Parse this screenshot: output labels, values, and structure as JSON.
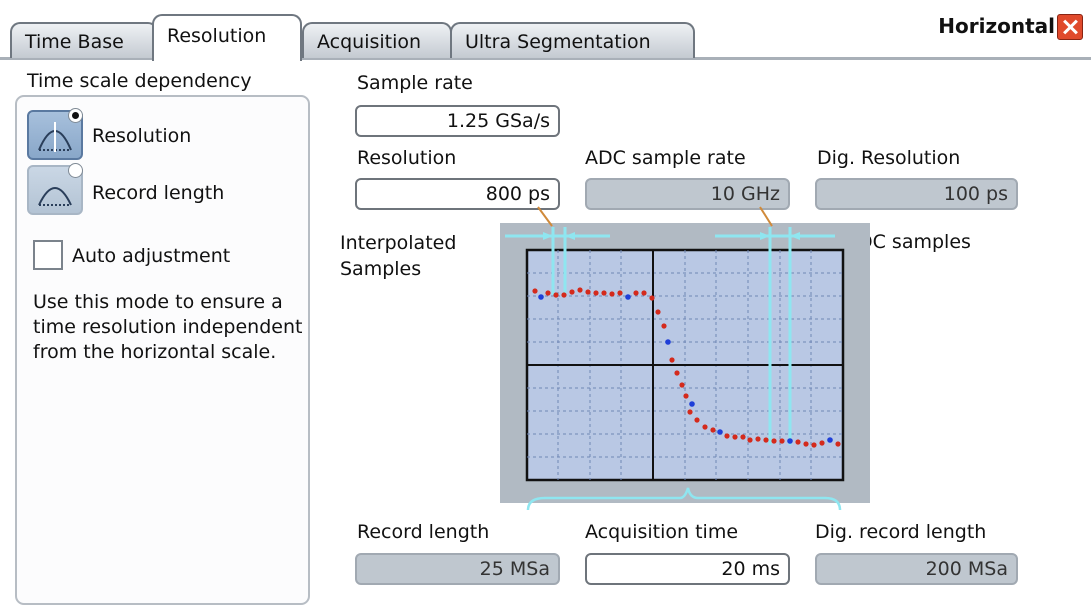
{
  "dialog": {
    "title": "Horizontal",
    "tabs": [
      {
        "label": "Time Base"
      },
      {
        "label": "Resolution"
      },
      {
        "label": "Acquisition"
      },
      {
        "label": "Ultra Segmentation"
      }
    ],
    "active_tab": "Resolution"
  },
  "left_panel": {
    "group_label": "Time scale dependency",
    "modes": [
      {
        "label": "Resolution",
        "selected": true,
        "icon": "resolution-mode-icon"
      },
      {
        "label": "Record length",
        "selected": false,
        "icon": "record-length-mode-icon"
      }
    ],
    "auto_adjustment": {
      "label": "Auto adjustment",
      "checked": false
    },
    "description": "Use this mode to ensure a time resolution independent from the horizontal scale."
  },
  "fields": {
    "sample_rate": {
      "label": "Sample rate",
      "value": "1.25 GSa/s"
    },
    "resolution": {
      "label": "Resolution",
      "value": "800 ps"
    },
    "adc_sample_rate": {
      "label": "ADC sample rate",
      "value": "10 GHz"
    },
    "dig_resolution": {
      "label": "Dig. Resolution",
      "value": "100 ps"
    },
    "record_length": {
      "label": "Record length",
      "value": "25 MSa"
    },
    "acquisition_time": {
      "label": "Acquisition time",
      "value": "20 ms"
    },
    "dig_record_length": {
      "label": "Dig. record length",
      "value": "200 MSa"
    }
  },
  "diagram": {
    "interpolated_label_line1": "Interpolated",
    "interpolated_label_line2": "Samples",
    "adc_label": "ADC samples"
  },
  "colors": {
    "accent": "#e04a2c",
    "adc_dot": "#1f3fd8",
    "interp_dot": "#d42a1c",
    "screen": "#b9c8e4",
    "marker": "#8fe6f0"
  }
}
